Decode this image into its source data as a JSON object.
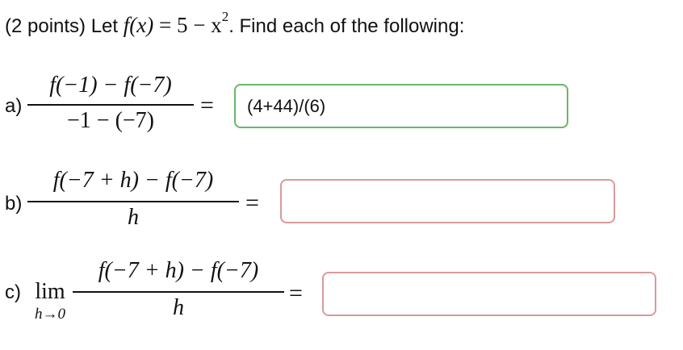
{
  "header": {
    "prefix": "(2 points) Let ",
    "func_lhs": "f(x)",
    "equals": " = ",
    "func_rhs_base": "5 − x",
    "func_rhs_exp": "2",
    "suffix": ". Find each of the following:"
  },
  "parts": [
    {
      "label": "a)",
      "numerator": "f(−1) − f(−7)",
      "denominator": "−1 − (−7)",
      "equals": "=",
      "answer": "(4+44)/(6)",
      "status": "correct"
    },
    {
      "label": "b)",
      "numerator": "f(−7 + h) − f(−7)",
      "denominator": "h",
      "equals": "=",
      "answer": "",
      "status": "incorrect"
    },
    {
      "label": "c)",
      "lim_word": "lim",
      "lim_sub": "h→0",
      "numerator": "f(−7 + h) − f(−7)",
      "denominator": "h",
      "equals": "=",
      "answer": "",
      "status": "incorrect"
    }
  ],
  "colors": {
    "correct_border": "#6ab56a",
    "incorrect_border": "#d99a9a",
    "text": "#111111"
  }
}
